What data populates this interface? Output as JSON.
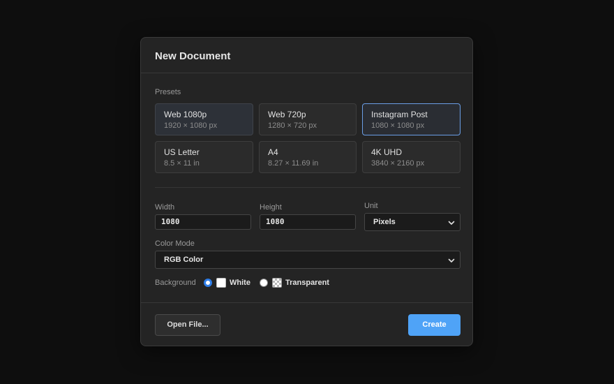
{
  "dialog": {
    "title": "New Document"
  },
  "presets": {
    "label": "Presets",
    "items": [
      {
        "name": "Web 1080p",
        "dims": "1920 × 1080 px",
        "state": "hover"
      },
      {
        "name": "Web 720p",
        "dims": "1280 × 720 px",
        "state": "normal"
      },
      {
        "name": "Instagram Post",
        "dims": "1080 × 1080 px",
        "state": "selected"
      },
      {
        "name": "US Letter",
        "dims": "8.5 × 11 in",
        "state": "normal"
      },
      {
        "name": "A4",
        "dims": "8.27 × 11.69 in",
        "state": "normal"
      },
      {
        "name": "4K UHD",
        "dims": "3840 × 2160 px",
        "state": "normal"
      }
    ]
  },
  "size": {
    "width_label": "Width",
    "width_value": "1080",
    "height_label": "Height",
    "height_value": "1080",
    "unit_label": "Unit",
    "unit_value": "Pixels"
  },
  "color_mode": {
    "label": "Color Mode",
    "value": "RGB Color"
  },
  "background": {
    "label": "Background",
    "options": [
      {
        "label": "White",
        "selected": true,
        "swatch": "white"
      },
      {
        "label": "Transparent",
        "selected": false,
        "swatch": "checker"
      }
    ]
  },
  "footer": {
    "open_label": "Open File...",
    "create_label": "Create"
  },
  "colors": {
    "accent": "#4fa3f7",
    "radio_on": "#2f7ee8",
    "selected_border": "#6a9ee6"
  }
}
